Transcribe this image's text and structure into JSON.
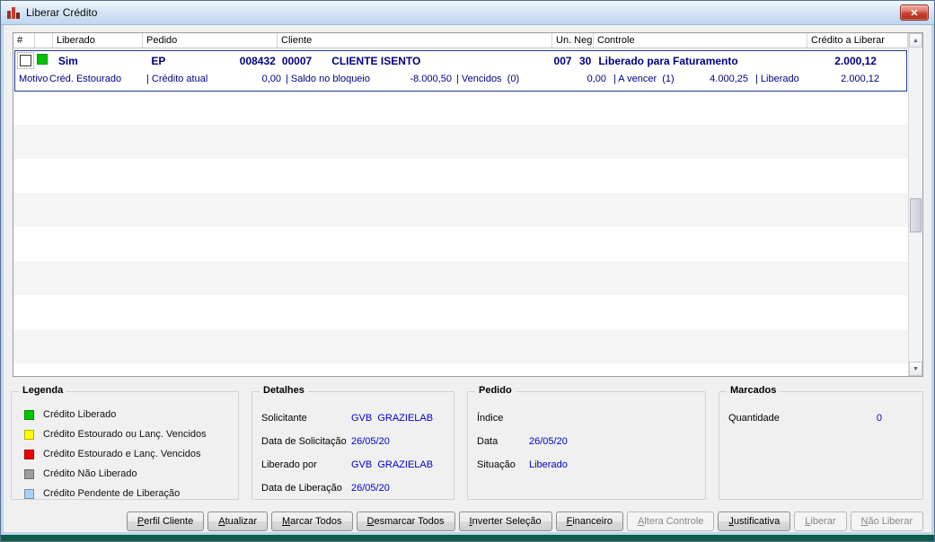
{
  "window": {
    "title": "Liberar Crédito"
  },
  "icons": {
    "close": "✕",
    "scroll_up": "▲",
    "scroll_down": "▼"
  },
  "grid": {
    "columns": [
      "#",
      "",
      "Liberado",
      "Pedido",
      "Cliente",
      "Un. Neg.",
      "Controle",
      "Crédito a Liberar"
    ],
    "row": {
      "checked": false,
      "status_color": "#00c400",
      "liberado": "Sim",
      "pedido_tipo": "EP",
      "pedido_numero": "008432",
      "cliente_codigo": "00007",
      "cliente_nome": "CLIENTE ISENTO",
      "un_neg": "007",
      "controle_codigo": "30",
      "controle_descricao": "Liberado para Faturamento",
      "credito_a_liberar": "2.000,12"
    },
    "motivo": {
      "label": "Motivo",
      "value": "Créd. Estourado",
      "credito_atual_label": "| Crédito atual",
      "credito_atual": "0,00",
      "saldo_bloqueio_label": "| Saldo no bloqueio",
      "saldo_bloqueio": "-8.000,50",
      "vencidos_label": "| Vencidos  (0)",
      "vencidos": "0,00",
      "a_vencer_label": "| A vencer  (1)",
      "a_vencer": "4.000,25",
      "liberado_label": "| Liberado",
      "liberado": "2.000,12"
    }
  },
  "legend": {
    "title": "Legenda",
    "items": [
      {
        "color": "#00c400",
        "label": "Crédito Liberado"
      },
      {
        "color": "#ffff00",
        "label": "Crédito Estourado ou Lanç. Vencidos"
      },
      {
        "color": "#f00000",
        "label": "Crédito Estourado e Lanç. Vencidos"
      },
      {
        "color": "#9c9c9c",
        "label": "Crédito Não Liberado"
      },
      {
        "color": "#a9d2f3",
        "label": "Crédito Pendente de Liberação"
      }
    ]
  },
  "detalhes": {
    "title": "Detalhes",
    "rows": [
      {
        "label": "Solicitante",
        "value": "GVB  GRAZIELAB"
      },
      {
        "label": "Data de Solicitação",
        "value": "26/05/20"
      },
      {
        "label": "Liberado por",
        "value": "GVB  GRAZIELAB"
      },
      {
        "label": "Data de Liberação",
        "value": "26/05/20"
      }
    ]
  },
  "pedido": {
    "title": "Pedido",
    "rows": [
      {
        "label": "Índice",
        "value": ""
      },
      {
        "label": "Data",
        "value": "26/05/20"
      },
      {
        "label": "Situação",
        "value": "Liberado"
      }
    ]
  },
  "marcados": {
    "title": "Marcados",
    "label": "Quantidade",
    "value": "0"
  },
  "buttons": [
    {
      "label": "Perfil Cliente",
      "enabled": true
    },
    {
      "label": "Atualizar",
      "enabled": true
    },
    {
      "label": "Marcar Todos",
      "enabled": true
    },
    {
      "label": "Desmarcar Todos",
      "enabled": true
    },
    {
      "label": "Inverter Seleção",
      "enabled": true
    },
    {
      "label": "Financeiro",
      "enabled": true
    },
    {
      "label": "Altera Controle",
      "enabled": false
    },
    {
      "label": "Justificativa",
      "enabled": true
    },
    {
      "label": "Liberar",
      "enabled": false
    },
    {
      "label": "Não Liberar",
      "enabled": false
    }
  ]
}
